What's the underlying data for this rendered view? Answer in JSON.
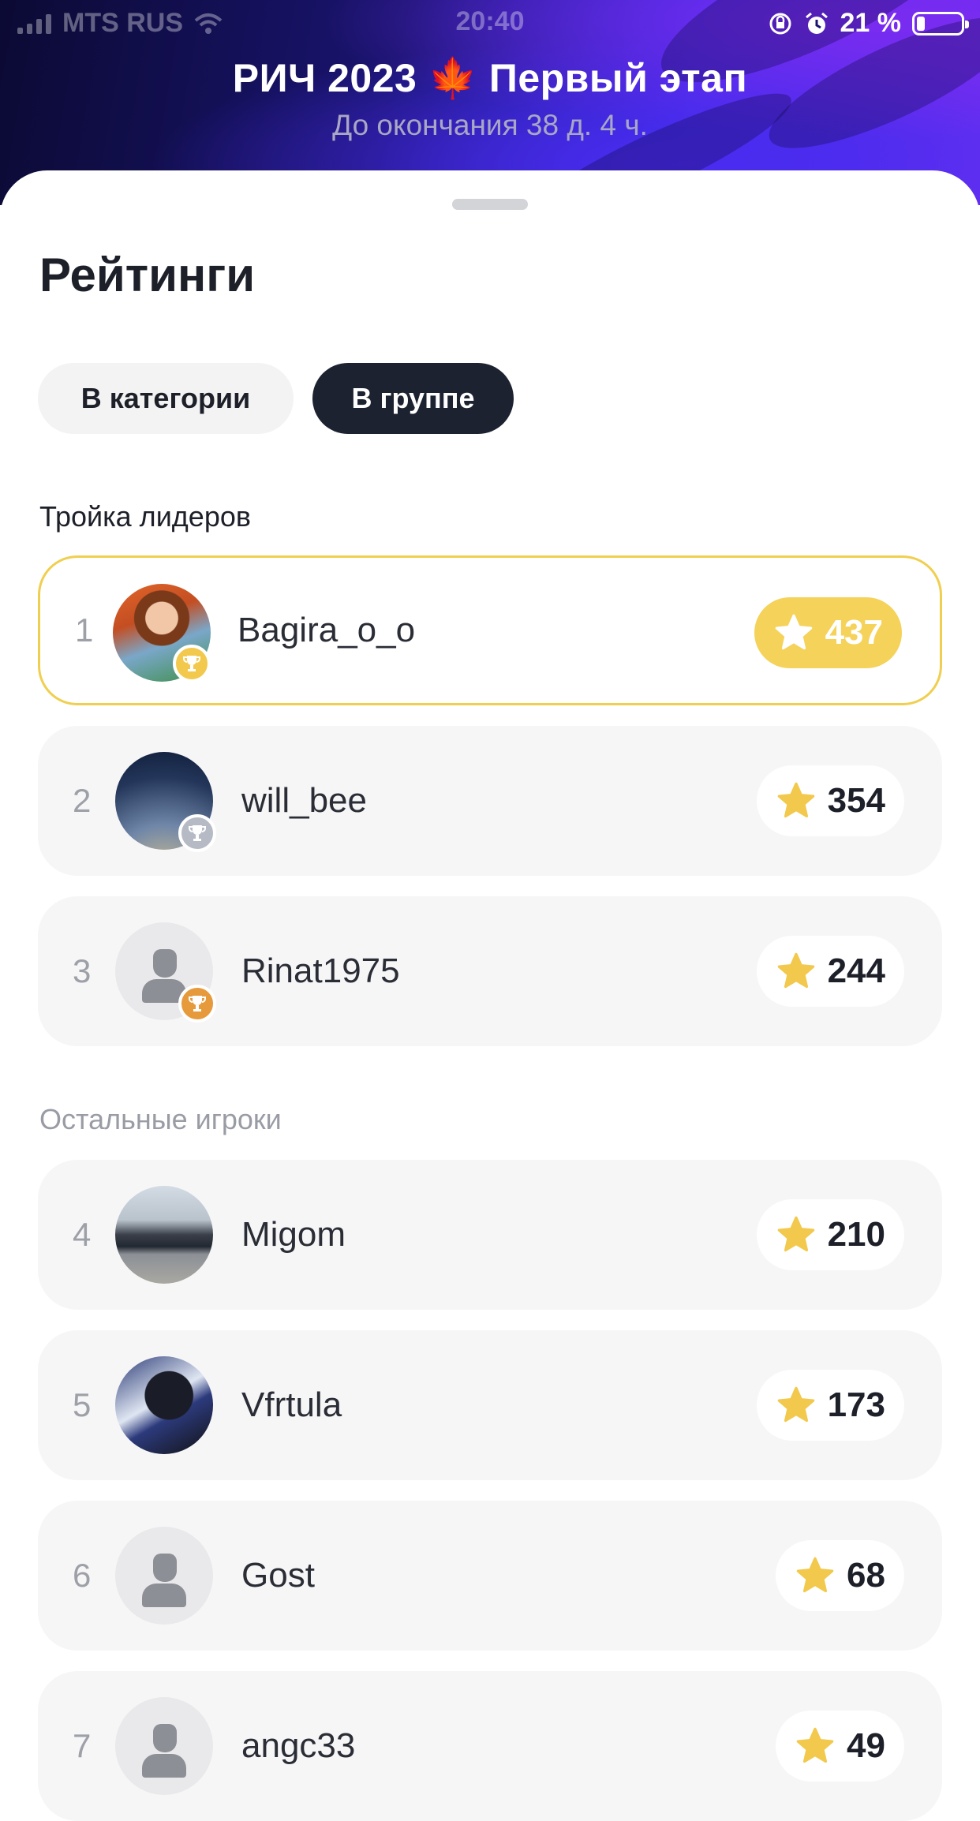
{
  "status_bar": {
    "carrier": "MTS RUS",
    "time": "20:40",
    "battery": "21 %"
  },
  "header": {
    "title": "РИЧ 2023 🍁 Первый этап",
    "subtitle": "До окончания 38 д. 4 ч."
  },
  "page": {
    "heading": "Рейтинги",
    "tabs": [
      {
        "label": "В категории",
        "selected": false
      },
      {
        "label": "В группе",
        "selected": true
      }
    ],
    "leaders_label": "Тройка лидеров",
    "others_label": "Остальные игроки"
  },
  "leaders": [
    {
      "rank": "1",
      "name": "Bagira_o_o",
      "score": "437",
      "medal": "gold"
    },
    {
      "rank": "2",
      "name": "will_bee",
      "score": "354",
      "medal": "silver"
    },
    {
      "rank": "3",
      "name": "Rinat1975",
      "score": "244",
      "medal": "bronze"
    }
  ],
  "others": [
    {
      "rank": "4",
      "name": "Migom",
      "score": "210"
    },
    {
      "rank": "5",
      "name": "Vfrtula",
      "score": "173"
    },
    {
      "rank": "6",
      "name": "Gost",
      "score": "68"
    },
    {
      "rank": "7",
      "name": "angc33",
      "score": "49"
    }
  ],
  "colors": {
    "accent_gold": "#f5d25a",
    "tab_active_bg": "#1d2230",
    "star": "#f2c94c"
  }
}
